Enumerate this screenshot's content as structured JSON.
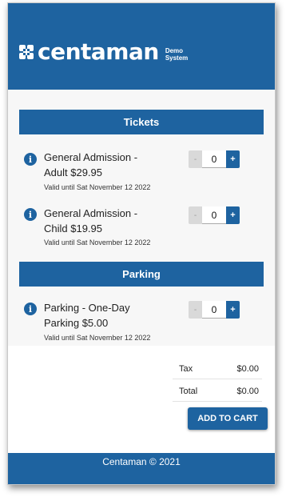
{
  "header": {
    "brand": "centaman",
    "sub_line1": "Demo",
    "sub_line2": "System"
  },
  "sections": [
    {
      "title": "Tickets",
      "items": [
        {
          "name_line1": "General Admission -",
          "name_line2": "Adult $29.95",
          "valid": "Valid until Sat November 12 2022",
          "qty": "0"
        },
        {
          "name_line1": "General Admission -",
          "name_line2": "Child $19.95",
          "valid": "Valid until Sat November 12 2022",
          "qty": "0"
        }
      ]
    },
    {
      "title": "Parking",
      "items": [
        {
          "name_line1": "Parking - One-Day",
          "name_line2": "Parking $5.00",
          "valid": "Valid until Sat November 12 2022",
          "qty": "0"
        }
      ]
    }
  ],
  "stepper": {
    "minus": "-",
    "plus": "+"
  },
  "info_glyph": "i",
  "totals": {
    "tax_label": "Tax",
    "tax_value": "$0.00",
    "total_label": "Total",
    "total_value": "$0.00"
  },
  "add_to_cart": "ADD TO CART",
  "footer": "Centaman © 2021",
  "colors": {
    "primary": "#1e63a0",
    "disabled": "#d9d9d9"
  }
}
